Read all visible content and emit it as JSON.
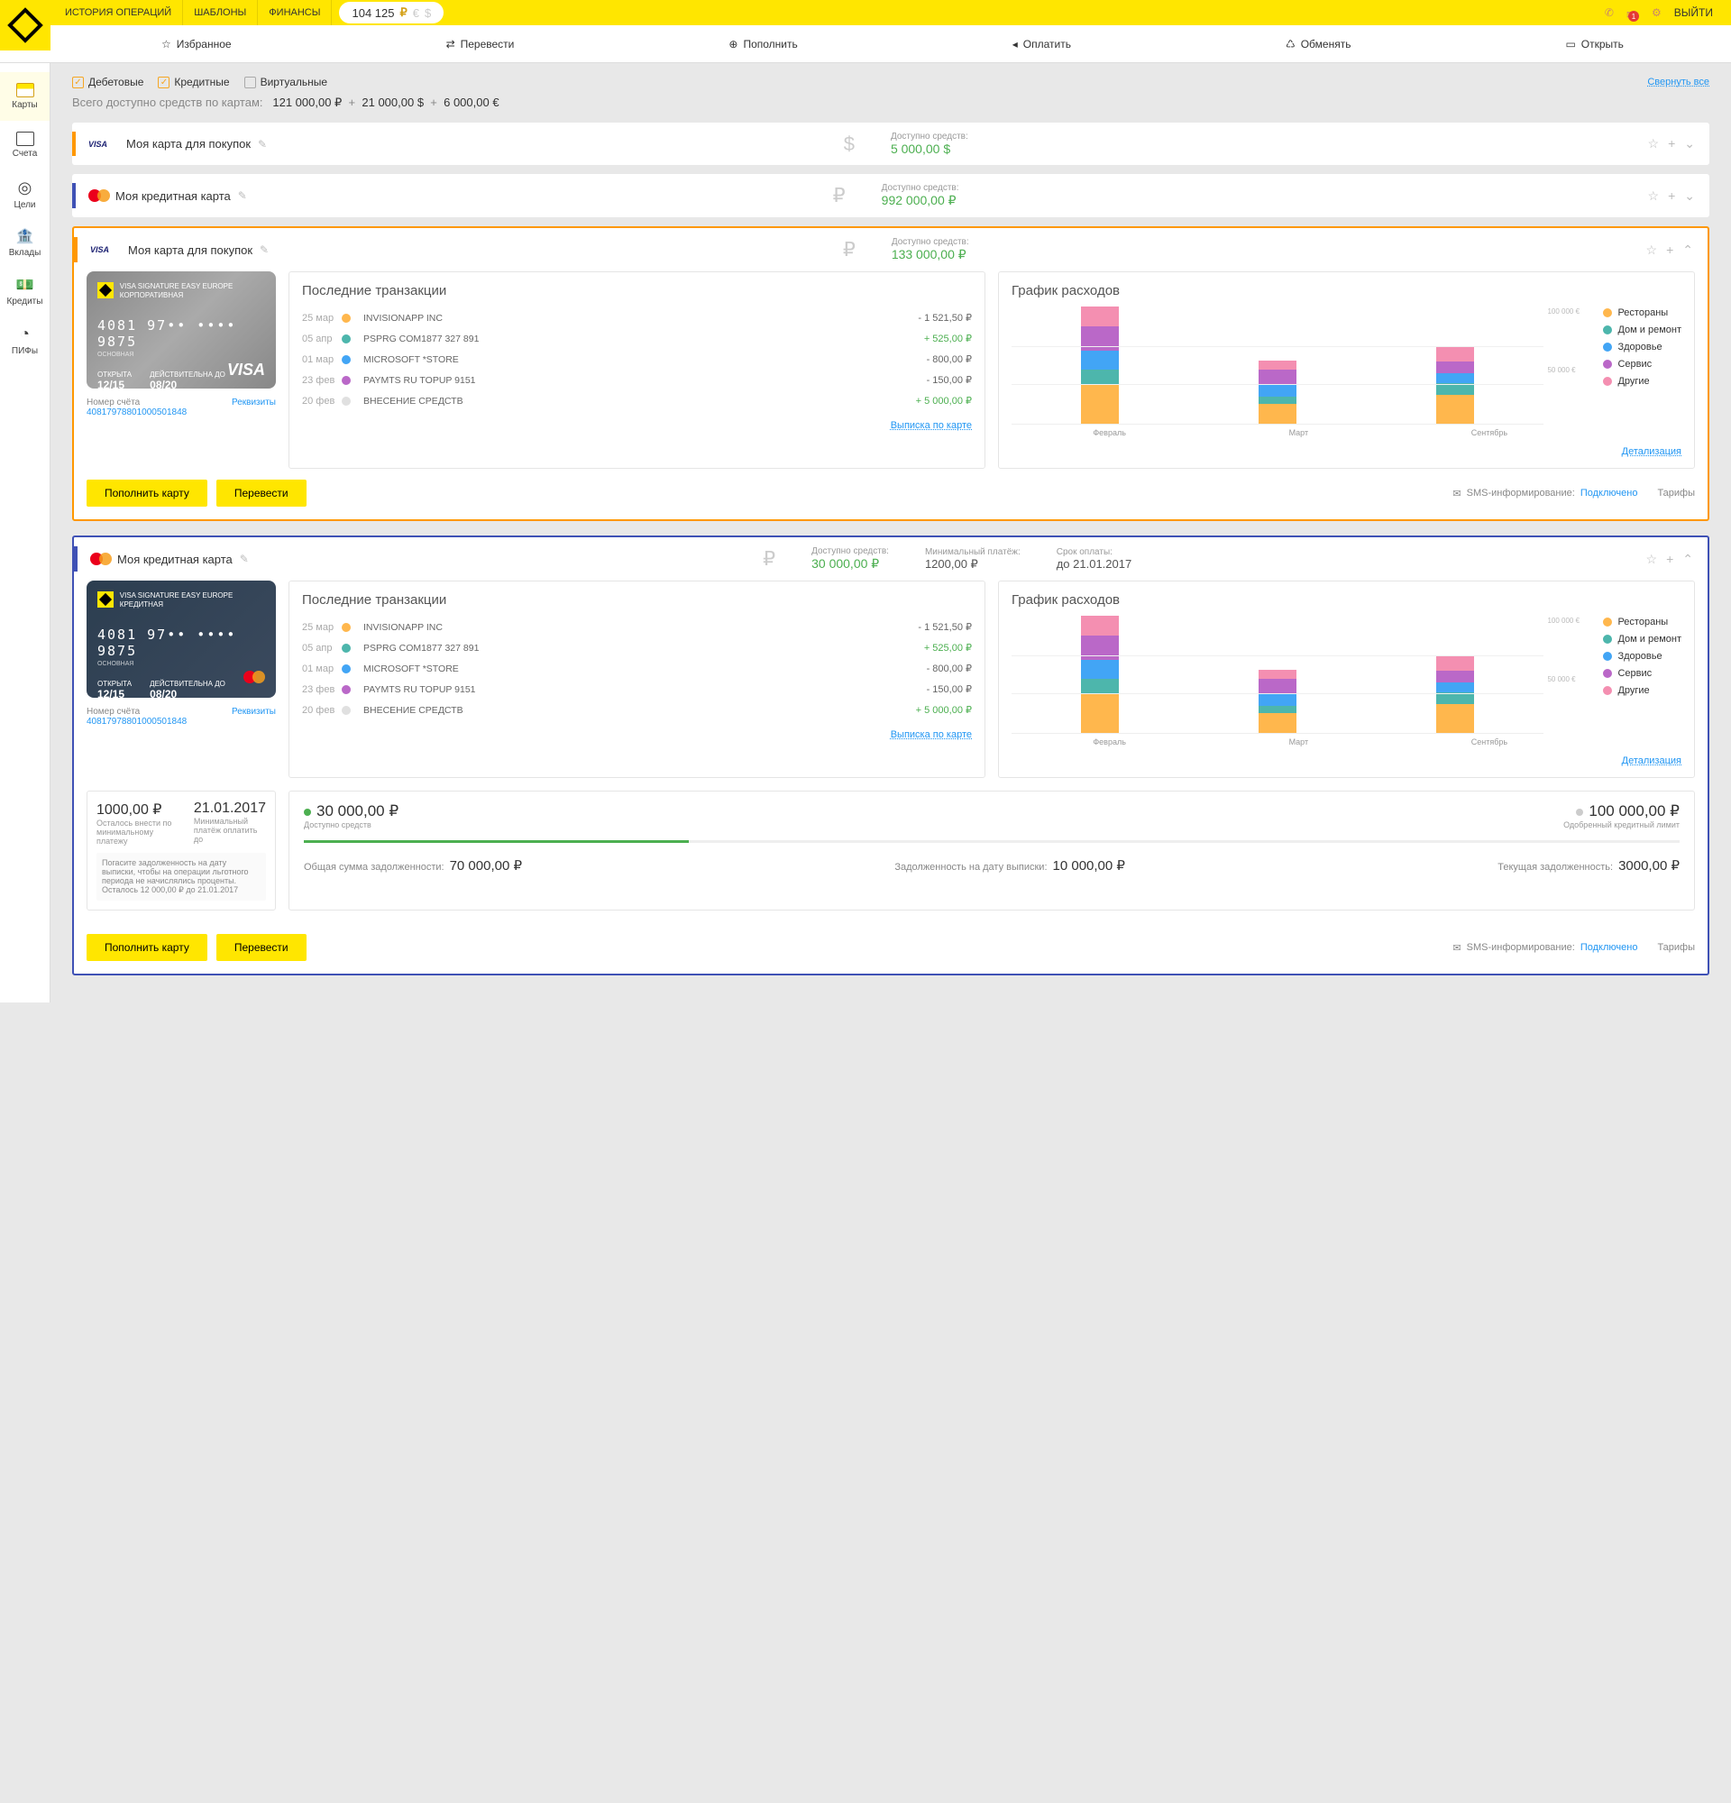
{
  "topnav": {
    "history": "ИСТОРИЯ ОПЕРАЦИЙ",
    "templates": "ШАБЛОНЫ",
    "finances": "ФИНАНСЫ"
  },
  "balance": "104 125",
  "logout": "ВЫЙТИ",
  "actions": {
    "fav": "Избранное",
    "transfer": "Перевести",
    "topup": "Пополнить",
    "pay": "Оплатить",
    "exchange": "Обменять",
    "open": "Открыть"
  },
  "sidebar": {
    "cards": "Карты",
    "accounts": "Счета",
    "goals": "Цели",
    "deposits": "Вклады",
    "credits": "Кредиты",
    "pifs": "ПИФы"
  },
  "filters": {
    "debit": "Дебетовые",
    "credit": "Кредитные",
    "virtual": "Виртуальные"
  },
  "collapse": "Свернуть все",
  "totals": {
    "label": "Всего доступно средств по картам:",
    "rub": "121 000,00 ₽",
    "usd": "21 000,00 $",
    "eur": "6 000,00 €"
  },
  "avail_label": "Доступно средств:",
  "strip1": {
    "name": "Моя карта для покупок",
    "avail": "5 000,00 $"
  },
  "strip2": {
    "name": "Моя кредитная карта",
    "avail": "992 000,00 ₽"
  },
  "strip3": {
    "name": "Моя карта для покупок",
    "avail": "133 000,00 ₽"
  },
  "strip4": {
    "name": "Моя кредитная карта",
    "avail": "30 000,00 ₽",
    "minpay_l": "Минимальный платёж:",
    "minpay_v": "1200,00 ₽",
    "due_l": "Срок оплаты:",
    "due_v": "до 21.01.2017"
  },
  "plastic": {
    "title": "VISA SIGNATURE EASY EUROPE",
    "sub1": "КОРПОРАТИВНАЯ",
    "sub2": "КРЕДИТНАЯ",
    "num": "4081  97••  ••••  9875",
    "main": "ОСНОВНАЯ",
    "open_l": "ОТКРЫТА",
    "open_v": "12/15",
    "valid_l": "ДЕЙСТВИТЕЛЬНА ДО",
    "valid_v": "08/20"
  },
  "acct": {
    "label": "Номер счёта",
    "num": "40817978801000501848",
    "req": "Реквизиты"
  },
  "txn_title": "Последние транзакции",
  "txns": [
    {
      "dt": "25 мар",
      "color": "#ffb74d",
      "nm": "INVISIONAPP INC",
      "amt": "- 1 521,50 ₽",
      "cls": "neg"
    },
    {
      "dt": "05 апр",
      "color": "#4db6ac",
      "nm": "PSPRG COM1877 327 891",
      "amt": "+ 525,00 ₽",
      "cls": "pos"
    },
    {
      "dt": "01 мар",
      "color": "#42a5f5",
      "nm": "MICROSOFT *STORE",
      "amt": "- 800,00 ₽",
      "cls": "neg"
    },
    {
      "dt": "23 фев",
      "color": "#ba68c8",
      "nm": "PAYMTS RU TOPUP 9151",
      "amt": "- 150,00 ₽",
      "cls": "neg"
    },
    {
      "dt": "20 фев",
      "color": "#e0e0e0",
      "nm": "ВНЕСЕНИЕ СРЕДСТВ",
      "amt": "+ 5 000,00 ₽",
      "cls": "pos"
    }
  ],
  "statement": "Выписка по карте",
  "chart_title": "График расходов",
  "chart_link": "Детализация",
  "chart_data": {
    "type": "bar",
    "categories": [
      "Февраль",
      "Март",
      "Сентябрь"
    ],
    "series": [
      {
        "name": "Рестораны",
        "color": "#ffb74d",
        "values": [
          40000,
          20000,
          30000
        ]
      },
      {
        "name": "Дом и ремонт",
        "color": "#4db6ac",
        "values": [
          15000,
          8000,
          12000
        ]
      },
      {
        "name": "Здоровье",
        "color": "#42a5f5",
        "values": [
          20000,
          12000,
          10000
        ]
      },
      {
        "name": "Сервис",
        "color": "#ba68c8",
        "values": [
          25000,
          15000,
          12000
        ]
      },
      {
        "name": "Другие",
        "color": "#f48fb1",
        "values": [
          20000,
          10000,
          15000
        ]
      }
    ],
    "ylabels": [
      "100 000 €",
      "50 000 €",
      ""
    ],
    "ymax": 120000
  },
  "legend": [
    {
      "c": "#ffb74d",
      "t": "Рестораны"
    },
    {
      "c": "#4db6ac",
      "t": "Дом и ремонт"
    },
    {
      "c": "#42a5f5",
      "t": "Здоровье"
    },
    {
      "c": "#ba68c8",
      "t": "Сервис"
    },
    {
      "c": "#f48fb1",
      "t": "Другие"
    }
  ],
  "btns": {
    "topup": "Пополнить карту",
    "transfer": "Перевести"
  },
  "sms": {
    "label": "SMS-информирование:",
    "status": "Подключено",
    "tarif": "Тарифы"
  },
  "credit": {
    "left_v1": "1000,00 ₽",
    "left_s1": "Осталось внести по минимальному платежу",
    "left_v2": "21.01.2017",
    "left_s2": "Минимальный платёж оплатить до",
    "note": "Погасите задолженность на дату выписки, чтобы на операции льготного периода не начислялись проценты.",
    "note2": "Осталось 12 000,00 ₽ до 21.01.2017",
    "avail": "30 000,00 ₽",
    "avail_l": "Доступно средств",
    "limit": "100 000,00 ₽",
    "limit_l": "Одобренный кредитный лимит",
    "debt1_l": "Общая сумма задолженности:",
    "debt1_v": "70 000,00 ₽",
    "debt2_l": "Задолженность на дату выписки:",
    "debt2_v": "10 000,00 ₽",
    "debt3_l": "Текущая задолженность:",
    "debt3_v": "3000,00 ₽"
  }
}
